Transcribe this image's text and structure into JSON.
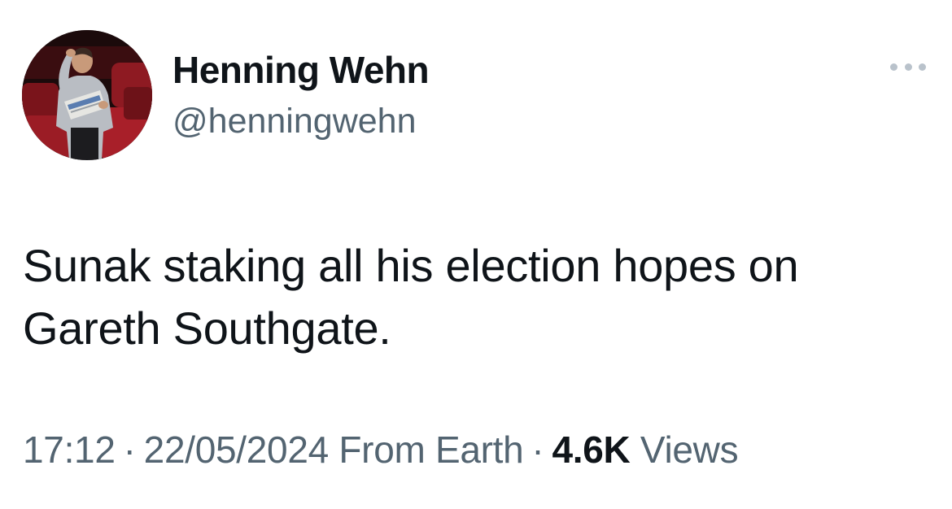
{
  "author": {
    "display_name": "Henning Wehn",
    "handle": "@henningwehn",
    "avatar_description_icon": "profile-photo"
  },
  "tweet": {
    "lines": [
      "Sunak staking all his election hopes on",
      "Gareth Southgate."
    ]
  },
  "meta": {
    "time": "17:12",
    "separator": "·",
    "date": "22/05/2024",
    "source": "From Earth",
    "views_count": "4.6K",
    "views_label": "Views"
  },
  "menu": {
    "icon": "more-horizontal-icon"
  },
  "colors": {
    "text_primary": "#0f1419",
    "text_secondary": "#536471",
    "more_dots": "#b9c2cb"
  }
}
